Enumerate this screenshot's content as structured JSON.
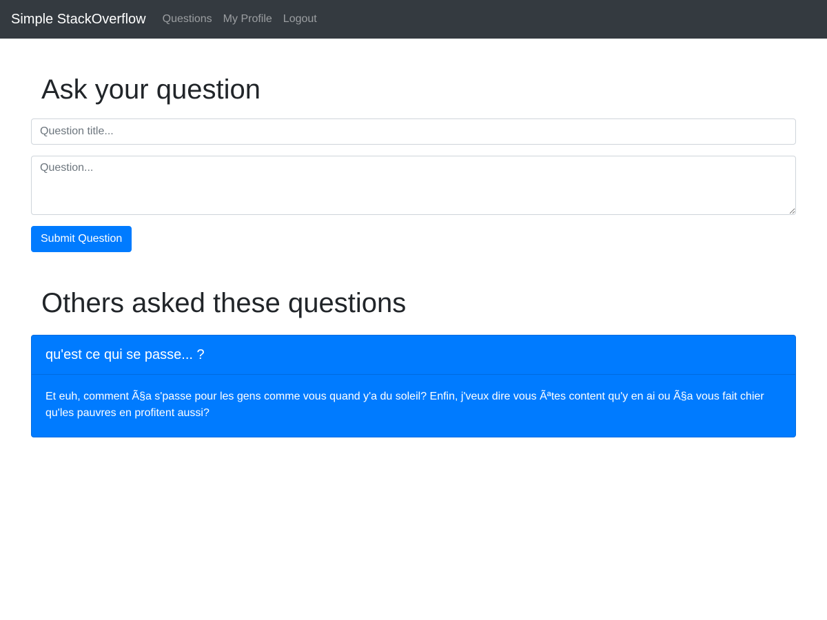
{
  "navbar": {
    "brand": "Simple StackOverflow",
    "links": [
      {
        "label": "Questions"
      },
      {
        "label": "My Profile"
      },
      {
        "label": "Logout"
      }
    ]
  },
  "ask": {
    "heading": "Ask your question",
    "title_placeholder": "Question title...",
    "title_value": "",
    "body_placeholder": "Question...",
    "body_value": "",
    "submit_label": "Submit Question"
  },
  "others": {
    "heading": "Others asked these questions",
    "questions": [
      {
        "title": "qu'est ce qui se passe... ?",
        "body": "Et euh, comment Ã§a s'passe pour les gens comme vous quand y'a du soleil? Enfin, j'veux dire vous Ãªtes content qu'y en ai ou Ã§a vous fait chier qu'les pauvres en profitent aussi?"
      }
    ]
  },
  "colors": {
    "navbar_bg": "#343a40",
    "primary": "#007bff",
    "text": "#212529"
  }
}
